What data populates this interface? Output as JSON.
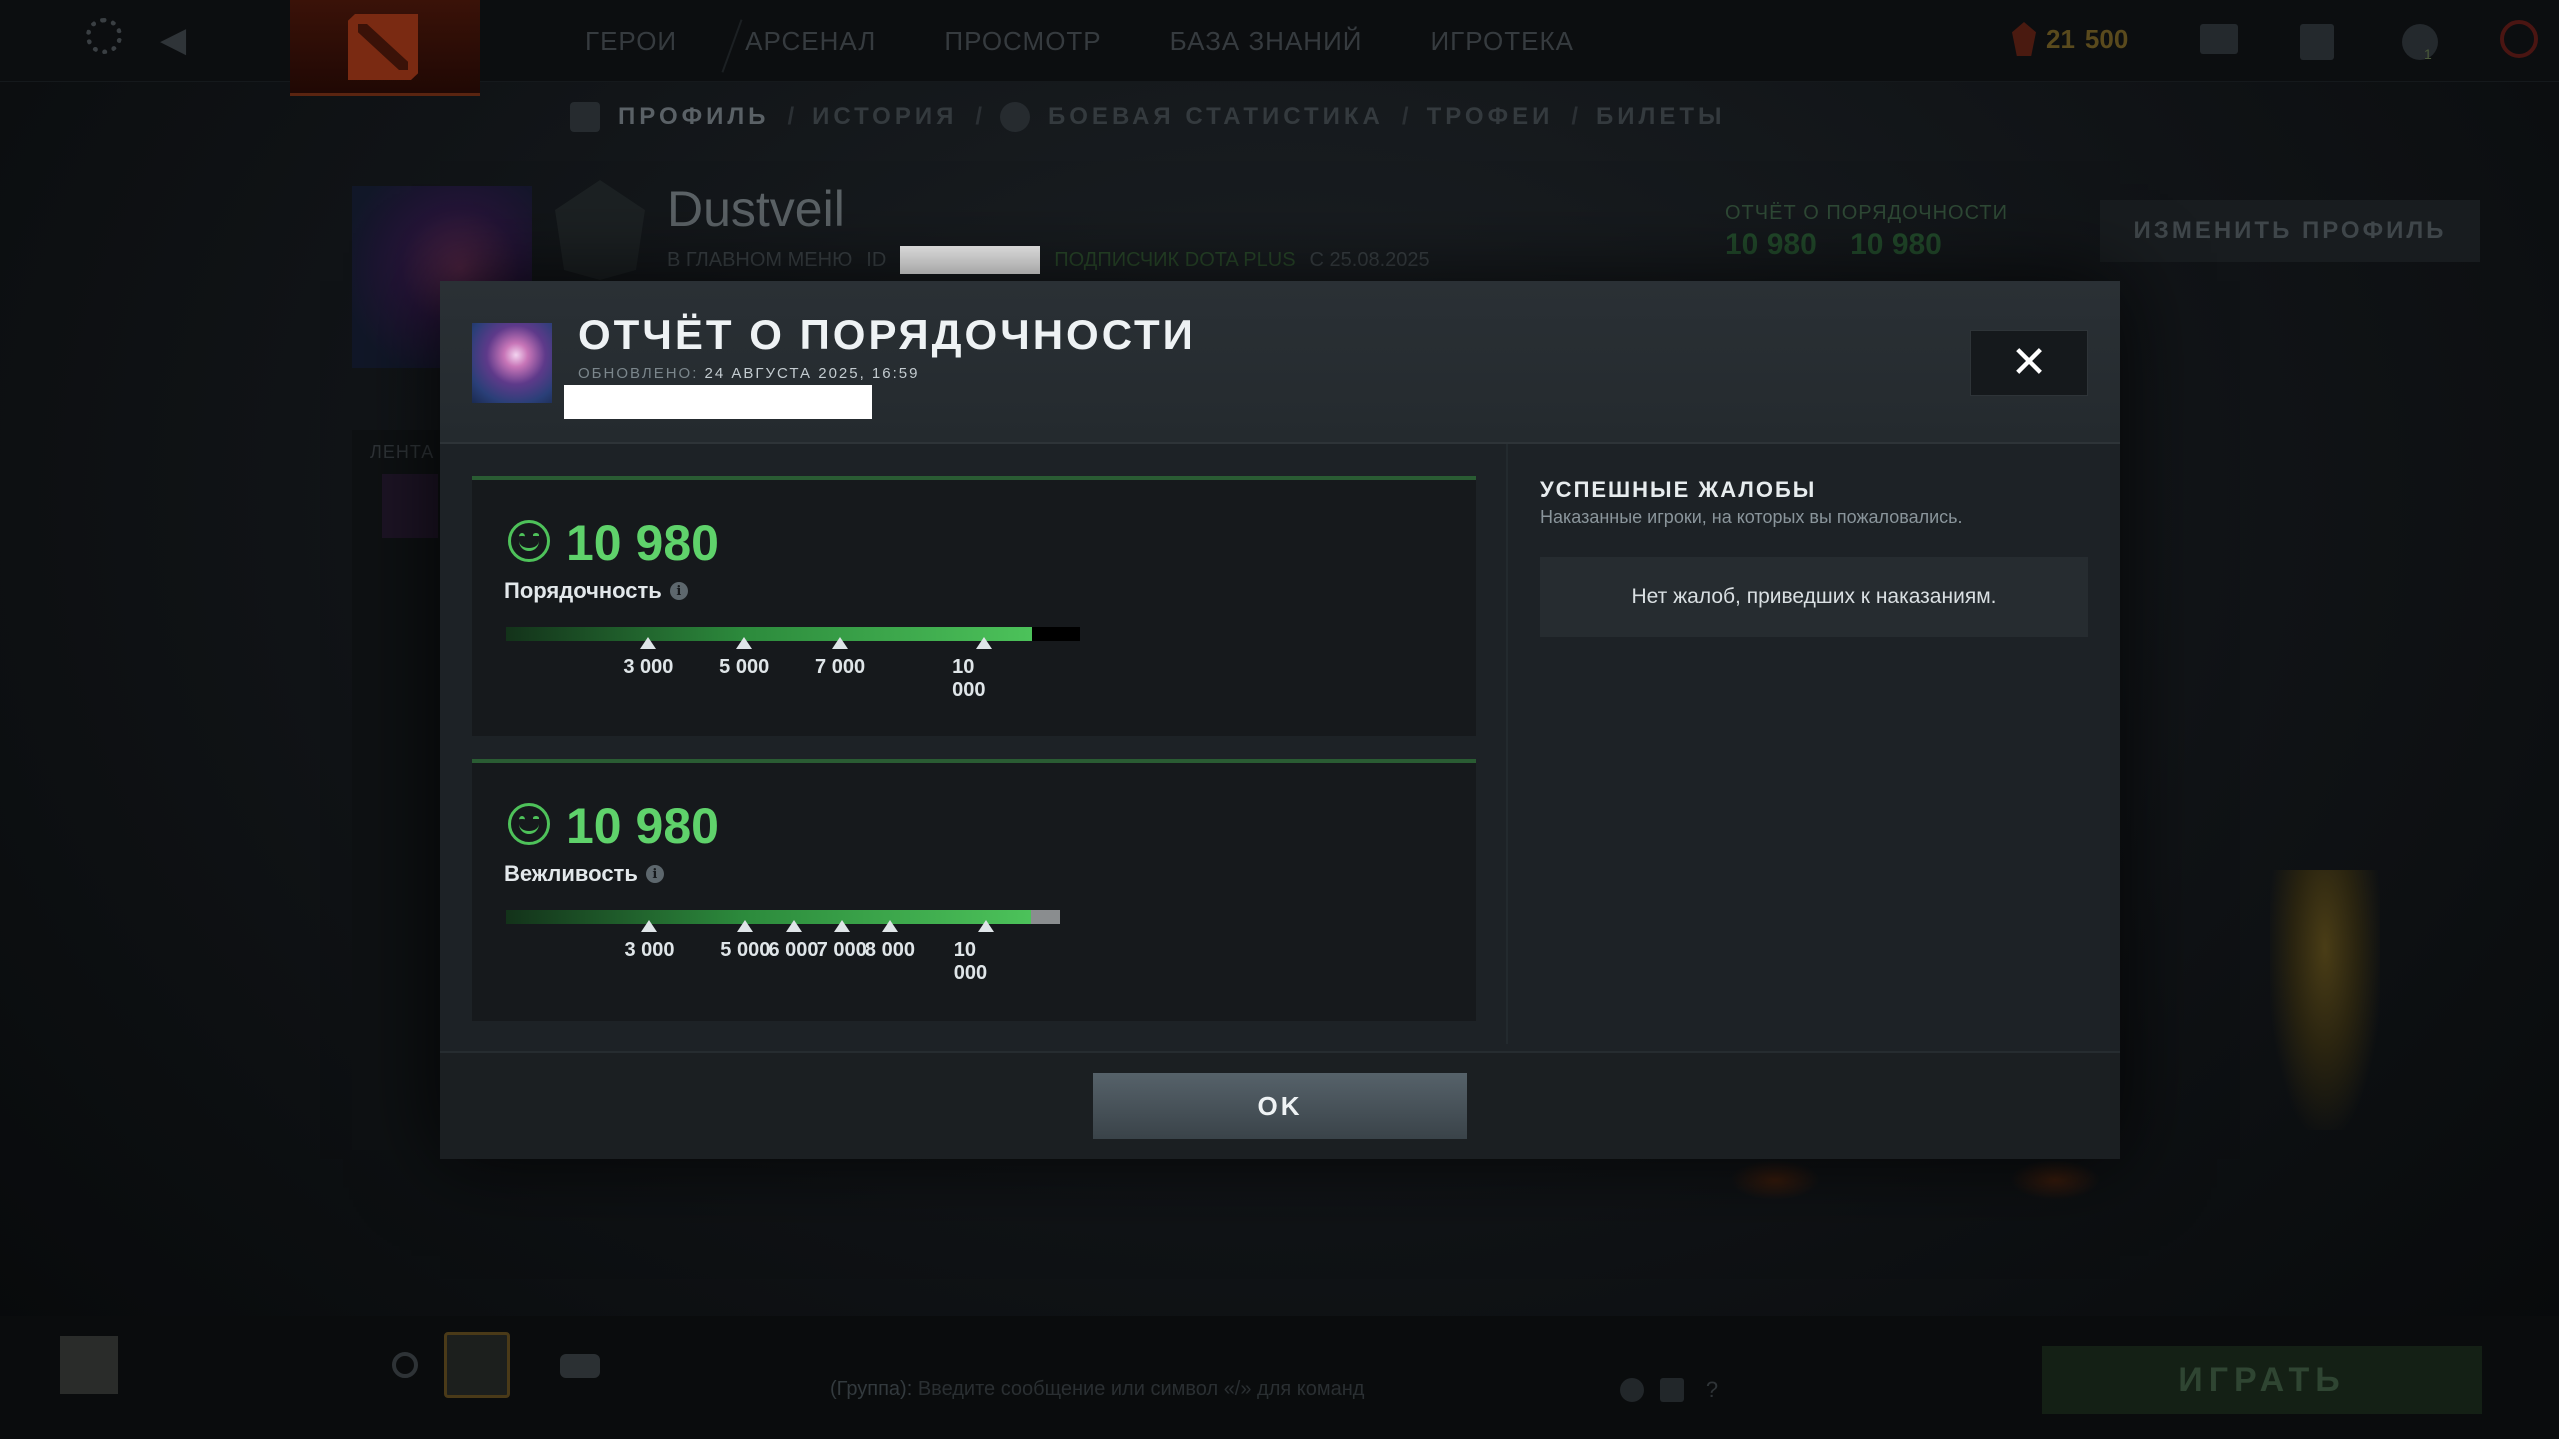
{
  "topbar": {
    "nav": [
      "ГЕРОИ",
      "АРСЕНАЛ",
      "ПРОСМОТР",
      "БАЗА ЗНАНИЙ",
      "ИГРОТЕКА"
    ],
    "currency_a": "21",
    "currency_b": "500",
    "notification_count": "1"
  },
  "subnav": {
    "profile": "ПРОФИЛЬ",
    "history": "ИСТОРИЯ",
    "stats": "БОЕВАЯ СТАТИСТИКА",
    "trophies": "ТРОФЕИ",
    "tickets": "БИЛЕТЫ",
    "sep": "/"
  },
  "profile": {
    "name": "Dustveil",
    "status": "В ГЛАВНОМ МЕНЮ",
    "id_label": "ID",
    "dota_plus": "ПОДПИСЧИК DOTA PLUS",
    "since": "С 25.08.2025",
    "conduct_label": "ОТЧЁТ О ПОРЯДОЧНОСТИ",
    "conduct_value_1": "10 980",
    "conduct_value_2": "10 980",
    "edit_button": "ИЗМЕНИТЬ ПРОФИЛЬ",
    "feed_label": "ЛЕНТА"
  },
  "modal": {
    "title": "ОТЧЁТ О ПОРЯДОЧНОСТИ",
    "updated_label": "ОБНОВЛЕНО:",
    "updated_value": "24 АВГУСТА 2025, 16:59",
    "close_glyph": "✕",
    "ok_button": "OK",
    "conduct": {
      "score": "10 980",
      "label": "Порядочность",
      "fill_fraction": 0.916,
      "ticks": [
        {
          "label": "3 000",
          "pos": 0.248
        },
        {
          "label": "5 000",
          "pos": 0.415
        },
        {
          "label": "7 000",
          "pos": 0.582
        },
        {
          "label": "10 000",
          "pos": 0.833
        }
      ],
      "track_color": "#000000"
    },
    "behavior": {
      "score": "10 980",
      "label": "Вежливость",
      "fill_fraction": 0.948,
      "ticks": [
        {
          "label": "3 000",
          "pos": 0.259
        },
        {
          "label": "5 000",
          "pos": 0.432
        },
        {
          "label": "6 000",
          "pos": 0.519
        },
        {
          "label": "7 000",
          "pos": 0.606
        },
        {
          "label": "8 000",
          "pos": 0.693
        },
        {
          "label": "10 000",
          "pos": 0.866
        }
      ],
      "track_color": "#8a8d8f"
    },
    "reports": {
      "title": "УСПЕШНЫЕ ЖАЛОБЫ",
      "subtitle": "Наказанные игроки, на которых вы пожаловались.",
      "empty": "Нет жалоб, приведших к наказаниям."
    }
  },
  "bottombar": {
    "chat_group": "(Группа):",
    "chat_hint": "Введите сообщение или символ «/» для команд",
    "help": "?",
    "play_button": "ИГРАТЬ"
  },
  "colors": {
    "accent_green": "#5fd26b",
    "bar_green": "#4cc25a"
  }
}
